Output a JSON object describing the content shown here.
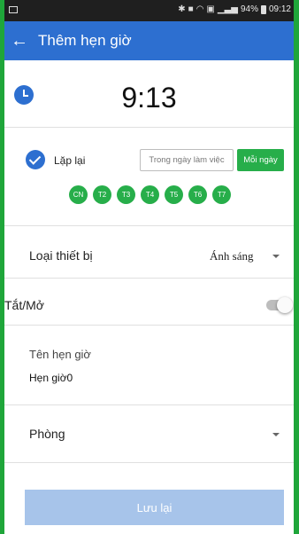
{
  "status_bar": {
    "icons": [
      "gallery-icon",
      "bluetooth-icon",
      "mute-icon",
      "wifi-icon",
      "nfc-icon",
      "signal-icon",
      "battery-icon"
    ],
    "battery": "94%",
    "time": "09:12"
  },
  "header": {
    "back_icon": "back-arrow-icon",
    "title": "Thêm hẹn giờ"
  },
  "timer": {
    "icon": "clock-icon",
    "time": "9:13"
  },
  "repeat": {
    "checked": true,
    "label": "Lặp lại",
    "weekday_button": "Trong ngày làm việc",
    "daily_button": "Mỗi ngày",
    "days": [
      "CN",
      "T2",
      "T3",
      "T4",
      "T5",
      "T6",
      "T7"
    ]
  },
  "device_type": {
    "label": "Loại thiết bị",
    "value": "Ánh sáng"
  },
  "on_off": {
    "label": "Tắt/Mở",
    "enabled": false
  },
  "timer_name": {
    "label": "Tên hẹn giờ",
    "value": "Hẹn giờ0"
  },
  "room": {
    "label": "Phòng",
    "value": ""
  },
  "save_label": "Lưu lại",
  "colors": {
    "primary": "#2d6fd0",
    "accent_green": "#27ae4a",
    "save_disabled": "#a7c4ea"
  }
}
